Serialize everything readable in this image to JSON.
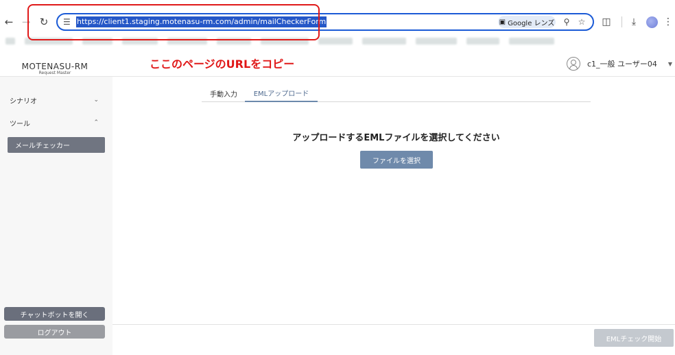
{
  "browser": {
    "url": "https://client1.staging.motenasu-rm.com/admin/mailCheckerForm",
    "lens_label": "Google レンズ",
    "icons": [
      "back-icon",
      "forward-icon",
      "reload-icon",
      "site-settings-icon",
      "lens-icon",
      "zoom-icon",
      "star-icon",
      "extensions-icon",
      "download-icon",
      "profile-avatar",
      "menu-icon"
    ]
  },
  "annotation": {
    "text": "ここのページのURLをコピー",
    "color": "#e01818"
  },
  "header": {
    "logo_main": "MOTENASU-RM",
    "logo_sub": "Request Master",
    "user_name": "c1_一般 ユーザー04"
  },
  "sidebar": {
    "groups": [
      {
        "label": "シナリオ",
        "expanded": false
      },
      {
        "label": "ツール",
        "expanded": true
      }
    ],
    "active_item": "メールチェッカー",
    "chatbot_button": "チャットボットを開く",
    "logout_button": "ログアウト"
  },
  "main": {
    "tabs": [
      {
        "label": "手動入力",
        "active": false
      },
      {
        "label": "EMLアップロード",
        "active": true
      }
    ],
    "upload_prompt": "アップロードするEMLファイルを選択してください",
    "select_file_button": "ファイルを選択",
    "start_button": "EMLチェック開始"
  },
  "colors": {
    "accent": "#6f8aab",
    "sidebar_active": "#707581",
    "url_highlight": "#2557c7",
    "omnibox_border": "#1a5ad6",
    "disabled_button": "#c4c9cf"
  }
}
